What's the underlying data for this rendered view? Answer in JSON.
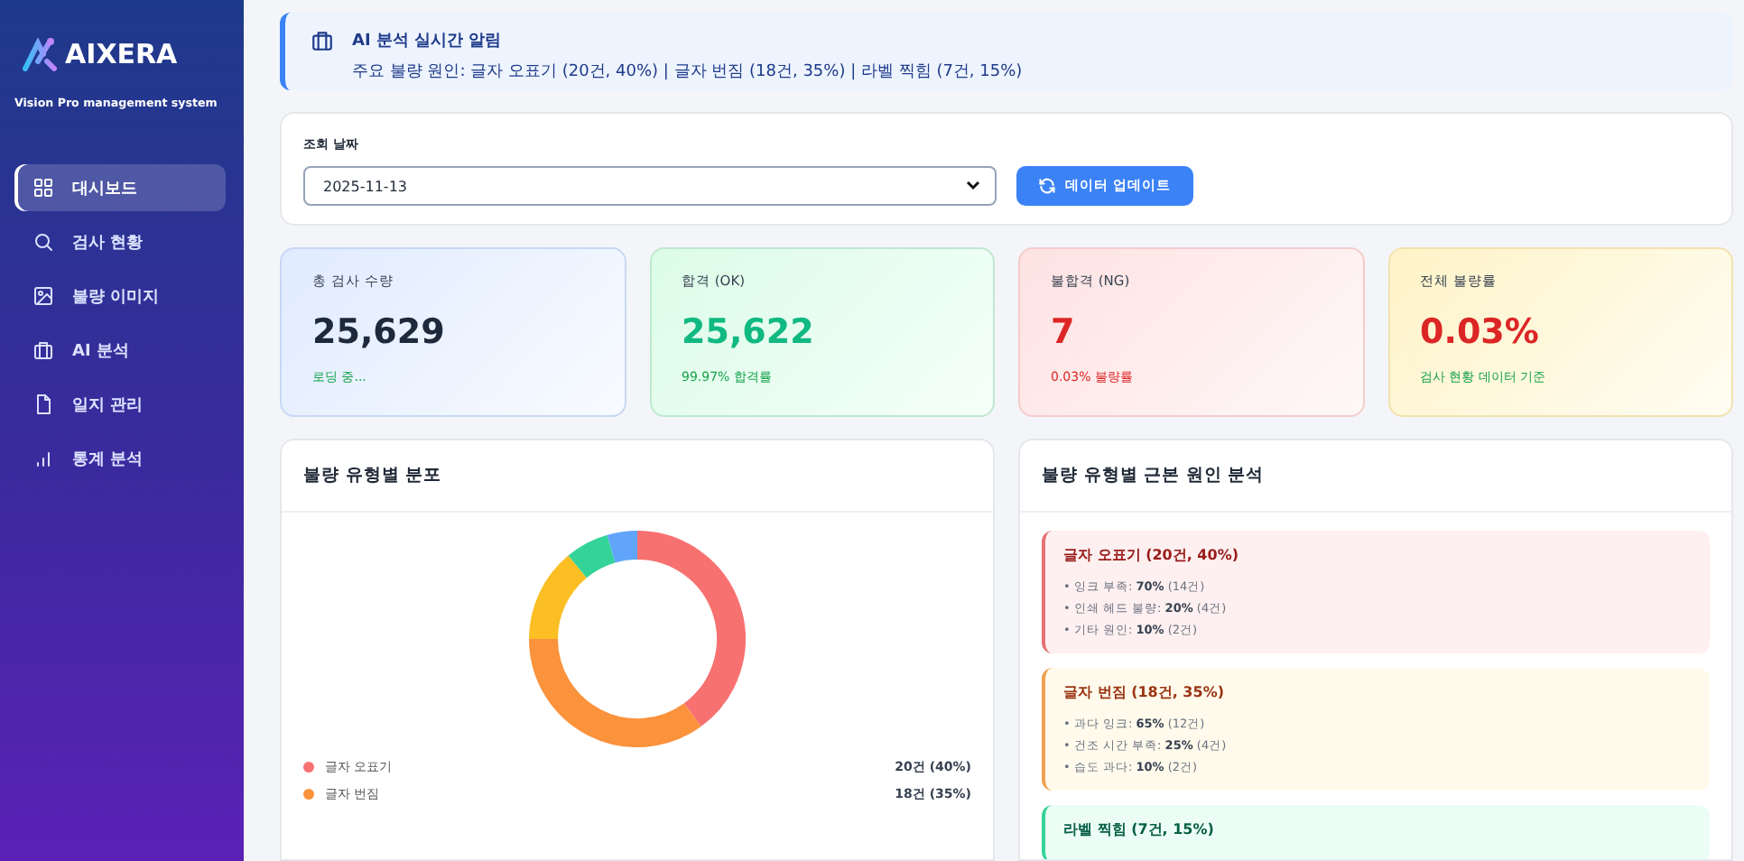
{
  "sidebar": {
    "logo": "AIXERA",
    "subtitle": "Vision Pro management system",
    "items": [
      {
        "label": "대시보드",
        "selected": true
      },
      {
        "label": "검사 현황",
        "selected": false
      },
      {
        "label": "불량 이미지",
        "selected": false
      },
      {
        "label": "AI 분석",
        "selected": false
      },
      {
        "label": "일지 관리",
        "selected": false
      },
      {
        "label": "통계 분석",
        "selected": false
      }
    ]
  },
  "alert": {
    "title": "AI 분석 실시간 알림",
    "message": "주요 불량 원인: 글자 오표기 (20건, 40%) | 글자 번짐 (18건, 35%) | 라벨 찍힘 (7건, 15%)"
  },
  "filter": {
    "label": "조회 날짜",
    "date": "2025-11-13",
    "button": "데이터 업데이트"
  },
  "stats": [
    {
      "kind": "info",
      "label": "총 검사 수량",
      "value": "25,629",
      "note": "로딩 중..."
    },
    {
      "kind": "ok",
      "label": "합격 (OK)",
      "value": "25,622",
      "note": "99.97% 합격률"
    },
    {
      "kind": "ng",
      "label": "불합격 (NG)",
      "value": "7",
      "note": "0.03% 불량률"
    },
    {
      "kind": "rate",
      "label": "전체 불량률",
      "value": "0.03%",
      "note": "검사 현황 데이터 기준"
    }
  ],
  "distribution": {
    "title": "불량 유형별 분포",
    "legend": [
      {
        "label": "글자 오표기",
        "value": "20건 (40%)",
        "color": "#f87171"
      },
      {
        "label": "글자 번짐",
        "value": "18건 (35%)",
        "color": "#fb923c"
      }
    ]
  },
  "causes": {
    "title": "불량 유형별 근본 원인 분석",
    "groups": [
      {
        "kind": "red",
        "title": "글자 오표기 (20건, 40%)",
        "items": [
          "• 잉크 부족: **70%** (14건)",
          "• 인쇄 헤드 불량: **20%** (4건)",
          "• 기타 원인: **10%** (2건)"
        ]
      },
      {
        "kind": "orange",
        "title": "글자 번짐 (18건, 35%)",
        "items": [
          "• 과다 잉크: **65%** (12건)",
          "• 건조 시간 부족: **25%** (4건)",
          "• 습도 과다: **10%** (2건)"
        ]
      },
      {
        "kind": "green",
        "title": "라벨 찍힘 (7건, 15%)"
      }
    ]
  }
}
